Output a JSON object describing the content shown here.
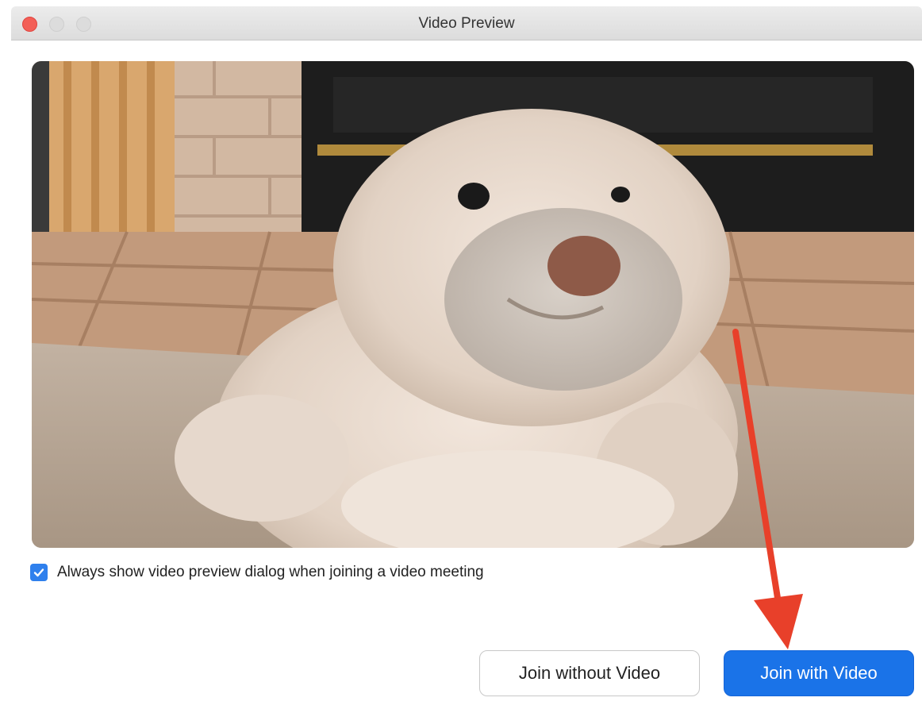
{
  "window": {
    "title": "Video Preview"
  },
  "preview": {
    "icon": "camera-preview-image"
  },
  "options": {
    "always_show_checked": true,
    "always_show_label": "Always show video preview dialog when joining a video meeting"
  },
  "buttons": {
    "join_without_video": "Join without Video",
    "join_with_video": "Join with Video"
  },
  "colors": {
    "primary": "#1a73e8",
    "close_dot": "#f35f57",
    "annotation_arrow": "#e8402a"
  }
}
